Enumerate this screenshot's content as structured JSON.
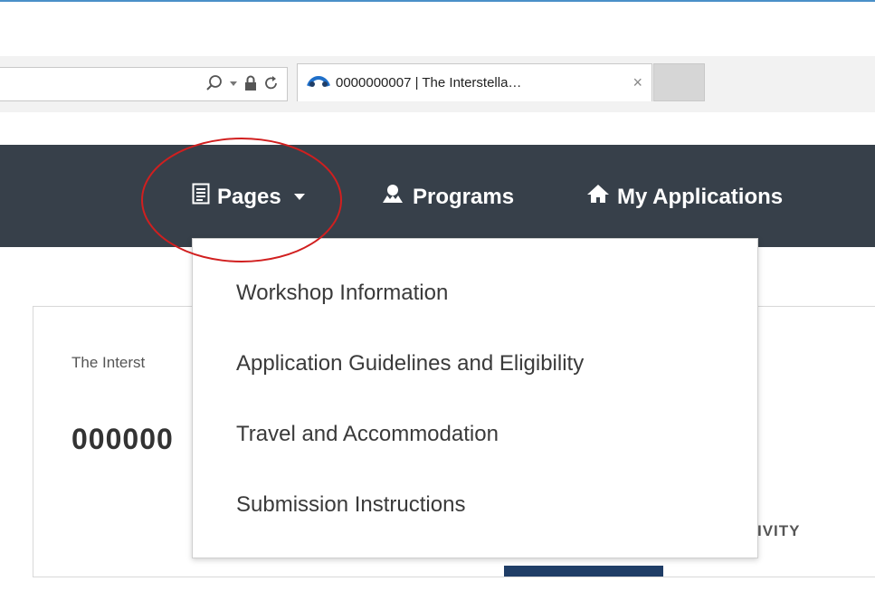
{
  "browser": {
    "tab_title": "0000000007 | The Interstella…",
    "tab_close": "×",
    "icons": {
      "search": "search-icon",
      "dropdown": "dropdown-icon",
      "lock": "lock-icon",
      "refresh": "refresh-icon"
    }
  },
  "nav": {
    "pages_label": "Pages",
    "programs_label": "Programs",
    "applications_label": "My Applications",
    "icons": {
      "pages": "document-icon",
      "programs": "programs-icon",
      "applications": "home-icon"
    }
  },
  "dropdown": {
    "items": [
      {
        "label": "Workshop Information"
      },
      {
        "label": "Application Guidelines and Eligibility"
      },
      {
        "label": "Travel and Accommodation"
      },
      {
        "label": "Submission Instructions"
      }
    ]
  },
  "card": {
    "subtitle": "The Interst",
    "record_id": "000000",
    "activity_label": "IVITY"
  },
  "colors": {
    "navbar": "#37404a",
    "accent": "#1f3d66",
    "annotation": "#d11f1f",
    "topline": "#4a90c8"
  }
}
